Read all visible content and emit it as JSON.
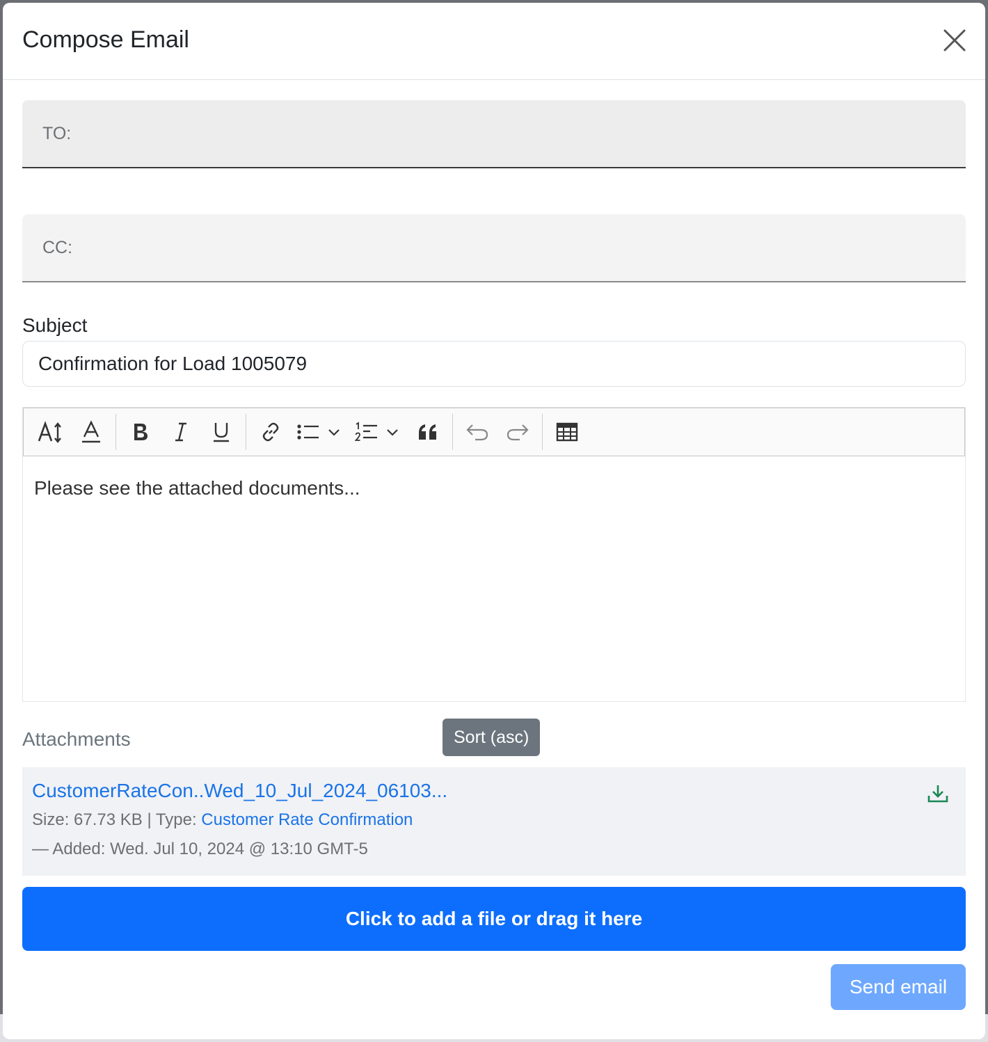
{
  "modal": {
    "title": "Compose Email"
  },
  "fields": {
    "to_label": "TO:",
    "to_value": "",
    "cc_label": "CC:",
    "cc_value": "",
    "subject_label": "Subject",
    "subject_value": "Confirmation for Load 1005079"
  },
  "toolbar": {
    "buttons": [
      "heading-icon",
      "font-color-icon",
      "bold-icon",
      "italic-icon",
      "underline-icon",
      "link-icon",
      "bullet-list-icon",
      "numbered-list-icon",
      "blockquote-icon",
      "undo-icon",
      "redo-icon",
      "table-icon"
    ]
  },
  "editor": {
    "content": "Please see the attached documents..."
  },
  "attachments": {
    "label": "Attachments",
    "tooltip": "Sort (asc)",
    "items": [
      {
        "name": "CustomerRateCon..Wed_10_Jul_2024_06103...",
        "size_label": "Size: 67.73 KB",
        "separator": "|",
        "type_label": "Type:",
        "type_value": "Customer Rate Confirmation",
        "added": "— Added: Wed. Jul 10, 2024 @ 13:10 GMT-5"
      }
    ]
  },
  "actions": {
    "add_file": "Click to add a file or drag it here",
    "send": "Send email"
  },
  "colors": {
    "primary": "#0d6efd",
    "primary_disabled": "#6ea8fe",
    "link": "#1a73e8",
    "download": "#198754"
  }
}
